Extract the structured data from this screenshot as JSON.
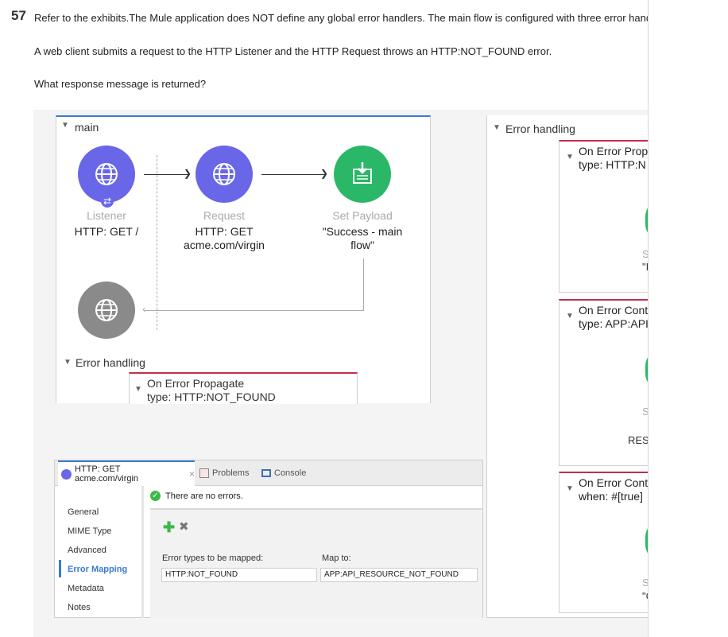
{
  "question": {
    "number": "57",
    "intro": "Refer to the exhibits.The Mule application does NOT define any global error handlers. The main flow is configured with three error handlers",
    "scenario": "A web client submits a request to the HTTP Listener and the HTTP Request throws an HTTP:NOT_FOUND error.",
    "prompt": "What response message is returned?"
  },
  "main_flow": {
    "title": "main",
    "listener": {
      "name": "Listener",
      "detail": "HTTP: GET /"
    },
    "request": {
      "name": "Request",
      "detail_line1": "HTTP: GET",
      "detail_line2": "acme.com/virgin"
    },
    "set_payload": {
      "name": "Set Payload",
      "detail_line1": "\"Success - main",
      "detail_line2": "flow\""
    },
    "error_section_label": "Error handling",
    "error_handler": {
      "title": "On Error Propagate",
      "type": "type: HTTP:NOT_FOUND"
    }
  },
  "right_error_panel": {
    "title": "Error handling",
    "handlers": [
      {
        "line1": "On Error Prop",
        "line2": "type: HTTP:N",
        "faint": "S",
        "dark": "\"I"
      },
      {
        "line1": "On Error Cont",
        "line2": "type: APP:API",
        "faint": "S",
        "dark": "RES"
      },
      {
        "line1": "On Error Cont",
        "line2": "when: #[true]",
        "faint": "S",
        "dark": "\"C"
      }
    ]
  },
  "properties_panel": {
    "tabs": {
      "active": "HTTP: GET acme.com/virgin",
      "problems": "Problems",
      "console": "Console"
    },
    "status": "There are no errors.",
    "nav": [
      "General",
      "MIME Type",
      "Advanced",
      "Error Mapping",
      "Metadata",
      "Notes"
    ],
    "column_error_types": "Error types to be mapped:",
    "column_map_to": "Map to:",
    "mapping": {
      "from": "HTTP:NOT_FOUND",
      "to": "APP:API_RESOURCE_NOT_FOUND"
    }
  }
}
